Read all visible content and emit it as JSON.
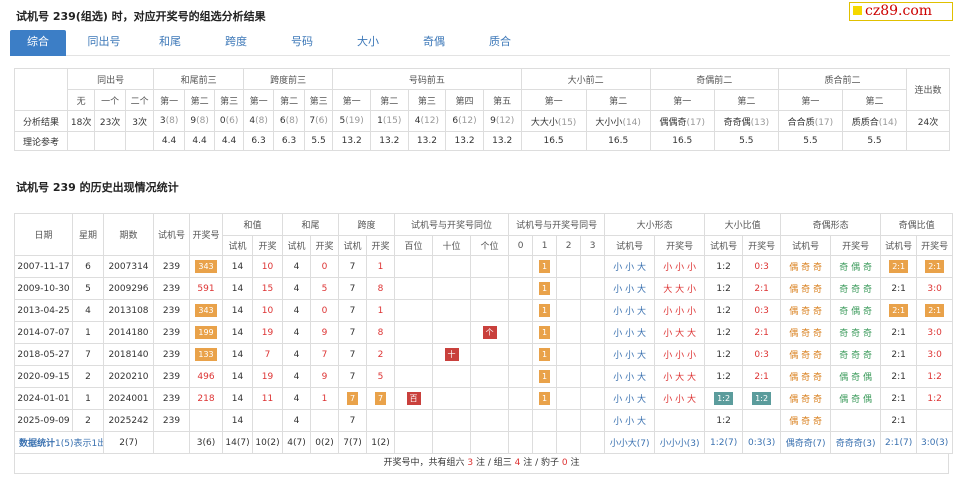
{
  "page_title": "试机号 239(组选) 时，对应开奖号的组选分析结果",
  "logo": "cz89.com",
  "tabs": [
    "综合",
    "同出号",
    "和尾",
    "跨度",
    "号码",
    "大小",
    "奇偶",
    "质合"
  ],
  "summary": {
    "groups": [
      "同出号",
      "和尾前三",
      "跨度前三",
      "号码前五",
      "大小前二",
      "奇偶前二",
      "质合前二",
      "连出数"
    ],
    "subs": [
      "无",
      "一个",
      "二个",
      "第一",
      "第二",
      "第三",
      "第一",
      "第二",
      "第三",
      "第一",
      "第二",
      "第三",
      "第四",
      "第五",
      "第一",
      "第二",
      "第一",
      "第二",
      "第一",
      "第二"
    ],
    "row1_label": "分析结果",
    "row1": [
      [
        "18次",
        ""
      ],
      [
        "23次",
        ""
      ],
      [
        "3次",
        ""
      ],
      [
        "3",
        "(8)"
      ],
      [
        "9",
        "(8)"
      ],
      [
        "0",
        "(6)"
      ],
      [
        "4",
        "(8)"
      ],
      [
        "6",
        "(8)"
      ],
      [
        "7",
        "(6)"
      ],
      [
        "5",
        "(19)"
      ],
      [
        "1",
        "(15)"
      ],
      [
        "4",
        "(12)"
      ],
      [
        "6",
        "(12)"
      ],
      [
        "9",
        "(12)"
      ],
      [
        "大大小",
        "(15)"
      ],
      [
        "大小小",
        "(14)"
      ],
      [
        "偶偶奇",
        "(17)"
      ],
      [
        "奇奇偶",
        "(13)"
      ],
      [
        "合合质",
        "(17)"
      ],
      [
        "质质合",
        "(14)"
      ],
      [
        "24次",
        ""
      ]
    ],
    "row2_label": "理论参考",
    "row2": [
      "",
      "",
      "",
      "4.4",
      "4.4",
      "4.4",
      "6.3",
      "6.3",
      "5.5",
      "13.2",
      "13.2",
      "13.2",
      "13.2",
      "13.2",
      "16.5",
      "16.5",
      "16.5",
      "5.5",
      "5.5",
      "5.5",
      ""
    ]
  },
  "section_title": "试机号 239 的历史出现情况统计",
  "history": {
    "head1": [
      "日期",
      "星期",
      "期数",
      "试机号",
      "开奖号",
      "和值",
      "和尾",
      "跨度",
      "试机号与开奖号同位",
      "试机号与开奖号同号",
      "大小形态",
      "大小比值",
      "奇偶形态",
      "奇偶比值"
    ],
    "head2": [
      "试机",
      "开奖",
      "试机",
      "开奖",
      "试机",
      "开奖",
      "百位",
      "十位",
      "个位",
      "0",
      "1",
      "2",
      "3",
      "试机号",
      "开奖号",
      "试机号",
      "开奖号",
      "试机号",
      "开奖号",
      "试机号",
      "开奖号"
    ],
    "rows": [
      {
        "date": "2007-11-17",
        "week": "6",
        "issue": "2007314",
        "test": "239",
        "draw": "343",
        "draw_hl": true,
        "sum_t": "14",
        "sum_d": "10",
        "tail_t": "4",
        "tail_d": "0",
        "span_t": "7",
        "span_d": "1",
        "pos": [
          "",
          "",
          ""
        ],
        "same": [
          "",
          "1",
          "",
          ""
        ],
        "bs_t": "小 小 大",
        "bs_d": "小 小 小",
        "bsr_t": "1:2",
        "bsr_d": "0:3",
        "bsr_hl": false,
        "oe_t": "偶 奇 奇",
        "oe_d": "奇 偶 奇",
        "oe_hl": true,
        "oer_t": "2:1",
        "oer_d": "2:1",
        "oer_hl": true
      },
      {
        "date": "2009-10-30",
        "week": "5",
        "issue": "2009296",
        "test": "239",
        "draw": "591",
        "draw_hl": false,
        "sum_t": "14",
        "sum_d": "15",
        "tail_t": "4",
        "tail_d": "5",
        "span_t": "7",
        "span_d": "8",
        "pos": [
          "",
          "",
          ""
        ],
        "same": [
          "",
          "1",
          "",
          ""
        ],
        "bs_t": "小 小 大",
        "bs_d": "大 大 小",
        "bsr_t": "1:2",
        "bsr_d": "2:1",
        "bsr_hl": false,
        "oe_t": "偶 奇 奇",
        "oe_d": "奇 奇 奇",
        "oe_hl": false,
        "oer_t": "2:1",
        "oer_d": "3:0",
        "oer_hl": false
      },
      {
        "date": "2013-04-25",
        "week": "4",
        "issue": "2013108",
        "test": "239",
        "draw": "343",
        "draw_hl": true,
        "sum_t": "14",
        "sum_d": "10",
        "tail_t": "4",
        "tail_d": "0",
        "span_t": "7",
        "span_d": "1",
        "pos": [
          "",
          "",
          ""
        ],
        "same": [
          "",
          "1",
          "",
          ""
        ],
        "bs_t": "小 小 大",
        "bs_d": "小 小 小",
        "bsr_t": "1:2",
        "bsr_d": "0:3",
        "bsr_hl": false,
        "oe_t": "偶 奇 奇",
        "oe_d": "奇 偶 奇",
        "oe_hl": true,
        "oer_t": "2:1",
        "oer_d": "2:1",
        "oer_hl": true
      },
      {
        "date": "2014-07-07",
        "week": "1",
        "issue": "2014180",
        "test": "239",
        "draw": "199",
        "draw_hl": true,
        "sum_t": "14",
        "sum_d": "19",
        "tail_t": "4",
        "tail_d": "9",
        "span_t": "7",
        "span_d": "8",
        "pos": [
          "",
          "",
          "个"
        ],
        "same": [
          "",
          "1",
          "",
          ""
        ],
        "bs_t": "小 小 大",
        "bs_d": "小 大 大",
        "bsr_t": "1:2",
        "bsr_d": "2:1",
        "bsr_hl": false,
        "oe_t": "偶 奇 奇",
        "oe_d": "奇 奇 奇",
        "oe_hl": false,
        "oer_t": "2:1",
        "oer_d": "3:0",
        "oer_hl": false
      },
      {
        "date": "2018-05-27",
        "week": "7",
        "issue": "2018140",
        "test": "239",
        "draw": "133",
        "draw_hl": true,
        "sum_t": "14",
        "sum_d": "7",
        "tail_t": "4",
        "tail_d": "7",
        "span_t": "7",
        "span_d": "2",
        "pos": [
          "",
          "十",
          ""
        ],
        "same": [
          "",
          "1",
          "",
          ""
        ],
        "bs_t": "小 小 大",
        "bs_d": "小 小 小",
        "bsr_t": "1:2",
        "bsr_d": "0:3",
        "bsr_hl": false,
        "oe_t": "偶 奇 奇",
        "oe_d": "奇 奇 奇",
        "oe_hl": false,
        "oer_t": "2:1",
        "oer_d": "3:0",
        "oer_hl": false
      },
      {
        "date": "2020-09-15",
        "week": "2",
        "issue": "2020210",
        "test": "239",
        "draw": "496",
        "draw_hl": false,
        "sum_t": "14",
        "sum_d": "19",
        "tail_t": "4",
        "tail_d": "9",
        "span_t": "7",
        "span_d": "5",
        "pos": [
          "",
          "",
          ""
        ],
        "same": [
          "",
          "1",
          "",
          ""
        ],
        "bs_t": "小 小 大",
        "bs_d": "小 大 大",
        "bsr_t": "1:2",
        "bsr_d": "2:1",
        "bsr_hl": false,
        "oe_t": "偶 奇 奇",
        "oe_d": "偶 奇 偶",
        "oe_hl": false,
        "oer_t": "2:1",
        "oer_d": "1:2",
        "oer_hl": false
      },
      {
        "date": "2024-01-01",
        "week": "1",
        "issue": "2024001",
        "test": "239",
        "draw": "218",
        "draw_hl": false,
        "sum_t": "14",
        "sum_d": "11",
        "tail_t": "4",
        "tail_d": "1",
        "span_t": "7",
        "span_d": "7",
        "span_hl": true,
        "pos": [
          "百",
          "",
          ""
        ],
        "same": [
          "",
          "1",
          "",
          ""
        ],
        "bs_t": "小 小 大",
        "bs_d": "小 小 大",
        "bsr_t": "1:2",
        "bsr_d": "1:2",
        "bsr_hl": true,
        "oe_t": "偶 奇 奇",
        "oe_d": "偶 奇 偶",
        "oe_hl": false,
        "oer_t": "2:1",
        "oer_d": "1:2",
        "oer_hl": false
      },
      {
        "date": "2025-09-09",
        "week": "2",
        "issue": "2025242",
        "test": "239",
        "draw": "",
        "draw_hl": false,
        "sum_t": "14",
        "sum_d": "",
        "tail_t": "4",
        "tail_d": "",
        "span_t": "7",
        "span_d": "",
        "pos": [
          "",
          "",
          ""
        ],
        "same": [
          "",
          "",
          "",
          ""
        ],
        "bs_t": "小 小 大",
        "bs_d": "",
        "bsr_t": "1:2",
        "bsr_d": "",
        "bsr_hl": false,
        "oe_t": "偶 奇 奇",
        "oe_d": "",
        "oe_hl": false,
        "oer_t": "2:1",
        "oer_d": "",
        "oer_hl": false
      }
    ],
    "stats": {
      "label": "数据统计",
      "desc": "1(5)表示1出现5次",
      "week": "2(7)",
      "issue": "3(6)",
      "sum_t": "14(7)",
      "sum_d": "10(2)",
      "tail_t": "4(7)",
      "tail_d": "0(2)",
      "span_t": "7(7)",
      "span_d": "1(2)",
      "bs_t": "小小大(7)",
      "bs_d": "小小小(3)",
      "bsr_t": "1:2(7)",
      "bsr_d": "0:3(3)",
      "oe_t": "偶奇奇(7)",
      "oe_d": "奇奇奇(3)",
      "oer_t": "2:1(7)",
      "oer_d": "3:0(3)"
    }
  },
  "footer": {
    "prefix": "开奖号中，共有组六",
    "c6": "3",
    "mid1": "注 / 组三",
    "c3": "4",
    "mid2": "注 / 豹子",
    "c0": "0",
    "suffix": "注"
  }
}
